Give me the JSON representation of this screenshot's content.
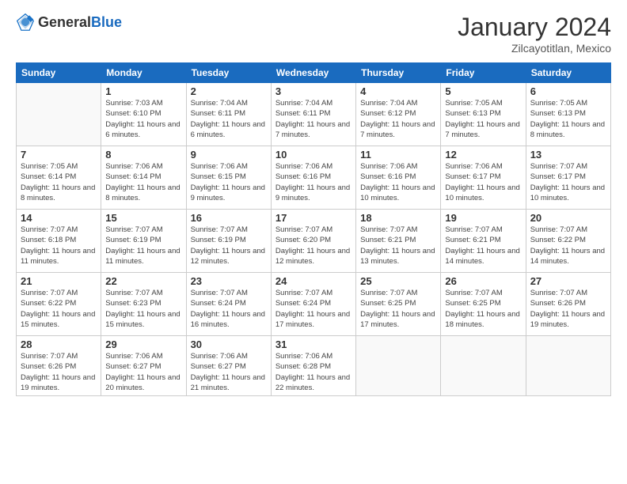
{
  "header": {
    "logo_general": "General",
    "logo_blue": "Blue",
    "month_title": "January 2024",
    "location": "Zilcayotitlan, Mexico"
  },
  "weekdays": [
    "Sunday",
    "Monday",
    "Tuesday",
    "Wednesday",
    "Thursday",
    "Friday",
    "Saturday"
  ],
  "weeks": [
    [
      {
        "date": "",
        "sunrise": "",
        "sunset": "",
        "daylight": ""
      },
      {
        "date": "1",
        "sunrise": "Sunrise: 7:03 AM",
        "sunset": "Sunset: 6:10 PM",
        "daylight": "Daylight: 11 hours and 6 minutes."
      },
      {
        "date": "2",
        "sunrise": "Sunrise: 7:04 AM",
        "sunset": "Sunset: 6:11 PM",
        "daylight": "Daylight: 11 hours and 6 minutes."
      },
      {
        "date": "3",
        "sunrise": "Sunrise: 7:04 AM",
        "sunset": "Sunset: 6:11 PM",
        "daylight": "Daylight: 11 hours and 7 minutes."
      },
      {
        "date": "4",
        "sunrise": "Sunrise: 7:04 AM",
        "sunset": "Sunset: 6:12 PM",
        "daylight": "Daylight: 11 hours and 7 minutes."
      },
      {
        "date": "5",
        "sunrise": "Sunrise: 7:05 AM",
        "sunset": "Sunset: 6:13 PM",
        "daylight": "Daylight: 11 hours and 7 minutes."
      },
      {
        "date": "6",
        "sunrise": "Sunrise: 7:05 AM",
        "sunset": "Sunset: 6:13 PM",
        "daylight": "Daylight: 11 hours and 8 minutes."
      }
    ],
    [
      {
        "date": "7",
        "sunrise": "Sunrise: 7:05 AM",
        "sunset": "Sunset: 6:14 PM",
        "daylight": "Daylight: 11 hours and 8 minutes."
      },
      {
        "date": "8",
        "sunrise": "Sunrise: 7:06 AM",
        "sunset": "Sunset: 6:14 PM",
        "daylight": "Daylight: 11 hours and 8 minutes."
      },
      {
        "date": "9",
        "sunrise": "Sunrise: 7:06 AM",
        "sunset": "Sunset: 6:15 PM",
        "daylight": "Daylight: 11 hours and 9 minutes."
      },
      {
        "date": "10",
        "sunrise": "Sunrise: 7:06 AM",
        "sunset": "Sunset: 6:16 PM",
        "daylight": "Daylight: 11 hours and 9 minutes."
      },
      {
        "date": "11",
        "sunrise": "Sunrise: 7:06 AM",
        "sunset": "Sunset: 6:16 PM",
        "daylight": "Daylight: 11 hours and 10 minutes."
      },
      {
        "date": "12",
        "sunrise": "Sunrise: 7:06 AM",
        "sunset": "Sunset: 6:17 PM",
        "daylight": "Daylight: 11 hours and 10 minutes."
      },
      {
        "date": "13",
        "sunrise": "Sunrise: 7:07 AM",
        "sunset": "Sunset: 6:17 PM",
        "daylight": "Daylight: 11 hours and 10 minutes."
      }
    ],
    [
      {
        "date": "14",
        "sunrise": "Sunrise: 7:07 AM",
        "sunset": "Sunset: 6:18 PM",
        "daylight": "Daylight: 11 hours and 11 minutes."
      },
      {
        "date": "15",
        "sunrise": "Sunrise: 7:07 AM",
        "sunset": "Sunset: 6:19 PM",
        "daylight": "Daylight: 11 hours and 11 minutes."
      },
      {
        "date": "16",
        "sunrise": "Sunrise: 7:07 AM",
        "sunset": "Sunset: 6:19 PM",
        "daylight": "Daylight: 11 hours and 12 minutes."
      },
      {
        "date": "17",
        "sunrise": "Sunrise: 7:07 AM",
        "sunset": "Sunset: 6:20 PM",
        "daylight": "Daylight: 11 hours and 12 minutes."
      },
      {
        "date": "18",
        "sunrise": "Sunrise: 7:07 AM",
        "sunset": "Sunset: 6:21 PM",
        "daylight": "Daylight: 11 hours and 13 minutes."
      },
      {
        "date": "19",
        "sunrise": "Sunrise: 7:07 AM",
        "sunset": "Sunset: 6:21 PM",
        "daylight": "Daylight: 11 hours and 14 minutes."
      },
      {
        "date": "20",
        "sunrise": "Sunrise: 7:07 AM",
        "sunset": "Sunset: 6:22 PM",
        "daylight": "Daylight: 11 hours and 14 minutes."
      }
    ],
    [
      {
        "date": "21",
        "sunrise": "Sunrise: 7:07 AM",
        "sunset": "Sunset: 6:22 PM",
        "daylight": "Daylight: 11 hours and 15 minutes."
      },
      {
        "date": "22",
        "sunrise": "Sunrise: 7:07 AM",
        "sunset": "Sunset: 6:23 PM",
        "daylight": "Daylight: 11 hours and 15 minutes."
      },
      {
        "date": "23",
        "sunrise": "Sunrise: 7:07 AM",
        "sunset": "Sunset: 6:24 PM",
        "daylight": "Daylight: 11 hours and 16 minutes."
      },
      {
        "date": "24",
        "sunrise": "Sunrise: 7:07 AM",
        "sunset": "Sunset: 6:24 PM",
        "daylight": "Daylight: 11 hours and 17 minutes."
      },
      {
        "date": "25",
        "sunrise": "Sunrise: 7:07 AM",
        "sunset": "Sunset: 6:25 PM",
        "daylight": "Daylight: 11 hours and 17 minutes."
      },
      {
        "date": "26",
        "sunrise": "Sunrise: 7:07 AM",
        "sunset": "Sunset: 6:25 PM",
        "daylight": "Daylight: 11 hours and 18 minutes."
      },
      {
        "date": "27",
        "sunrise": "Sunrise: 7:07 AM",
        "sunset": "Sunset: 6:26 PM",
        "daylight": "Daylight: 11 hours and 19 minutes."
      }
    ],
    [
      {
        "date": "28",
        "sunrise": "Sunrise: 7:07 AM",
        "sunset": "Sunset: 6:26 PM",
        "daylight": "Daylight: 11 hours and 19 minutes."
      },
      {
        "date": "29",
        "sunrise": "Sunrise: 7:06 AM",
        "sunset": "Sunset: 6:27 PM",
        "daylight": "Daylight: 11 hours and 20 minutes."
      },
      {
        "date": "30",
        "sunrise": "Sunrise: 7:06 AM",
        "sunset": "Sunset: 6:27 PM",
        "daylight": "Daylight: 11 hours and 21 minutes."
      },
      {
        "date": "31",
        "sunrise": "Sunrise: 7:06 AM",
        "sunset": "Sunset: 6:28 PM",
        "daylight": "Daylight: 11 hours and 22 minutes."
      },
      {
        "date": "",
        "sunrise": "",
        "sunset": "",
        "daylight": ""
      },
      {
        "date": "",
        "sunrise": "",
        "sunset": "",
        "daylight": ""
      },
      {
        "date": "",
        "sunrise": "",
        "sunset": "",
        "daylight": ""
      }
    ]
  ]
}
